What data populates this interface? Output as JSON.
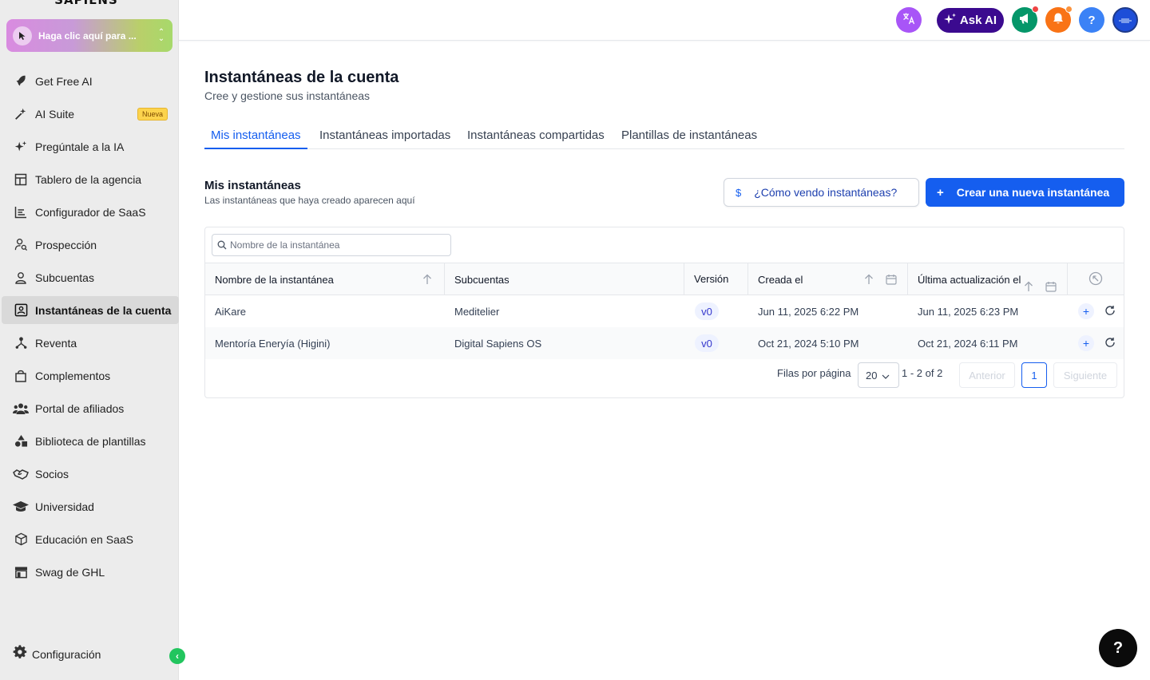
{
  "brand": "SAPIENS",
  "switcher": {
    "label": "Haga clic aquí para ..."
  },
  "sidebar": {
    "items": [
      {
        "label": "Get Free AI",
        "icon": "rocket-icon"
      },
      {
        "label": "AI Suite",
        "icon": "sparkle-wand-icon",
        "badge": "Nueva"
      },
      {
        "label": "Pregúntale a la IA",
        "icon": "sparkles-icon"
      },
      {
        "label": "Tablero de la agencia",
        "icon": "dashboard-icon"
      },
      {
        "label": "Configurador de SaaS",
        "icon": "bar-chart-icon"
      },
      {
        "label": "Prospección",
        "icon": "user-search-icon"
      },
      {
        "label": "Subcuentas",
        "icon": "user-icon"
      },
      {
        "label": "Instantáneas de la cuenta",
        "icon": "snapshot-icon",
        "active": true
      },
      {
        "label": "Reventa",
        "icon": "network-icon"
      },
      {
        "label": "Complementos",
        "icon": "bag-icon"
      },
      {
        "label": "Portal de afiliados",
        "icon": "users-icon"
      },
      {
        "label": "Biblioteca de plantillas",
        "icon": "shapes-icon"
      },
      {
        "label": "Socios",
        "icon": "handshake-icon"
      },
      {
        "label": "Universidad",
        "icon": "graduation-cap-icon"
      },
      {
        "label": "Educación en SaaS",
        "icon": "cube-icon"
      },
      {
        "label": "Swag de GHL",
        "icon": "store-icon"
      }
    ],
    "settings_label": "Configuración"
  },
  "topbar": {
    "ask_ai_label": "Ask AI",
    "help_label": "?"
  },
  "page": {
    "title": "Instantáneas de la cuenta",
    "subtitle": "Cree y gestione sus instantáneas",
    "tabs": [
      "Mis instantáneas",
      "Instantáneas importadas",
      "Instantáneas compartidas",
      "Plantillas de instantáneas"
    ],
    "section_title": "Mis instantáneas",
    "section_subtitle": "Las instantáneas que haya creado aparecen aquí",
    "how_sell_label": "¿Cómo vendo instantáneas?",
    "create_label": "Crear una nueva instantánea"
  },
  "table": {
    "search_placeholder": "Nombre de la instantánea",
    "columns": [
      "Nombre de la instantánea",
      "Subcuentas",
      "Versión",
      "Creada el",
      "Última actualización el"
    ],
    "rows": [
      {
        "name": "AiKare",
        "subaccount": "Meditelier",
        "version": "v0",
        "created": "Jun 11, 2025 6:22 PM",
        "updated": "Jun 11, 2025 6:23 PM"
      },
      {
        "name": "Mentoría Eneryía (Higini)",
        "subaccount": "Digital Sapiens OS",
        "version": "v0",
        "created": "Oct 21, 2024 5:10 PM",
        "updated": "Oct 21, 2024 6:11 PM"
      }
    ]
  },
  "pagination": {
    "rows_per_page_label": "Filas por página",
    "rows_per_page": "20",
    "range": "1 - 2 of 2",
    "prev_label": "Anterior",
    "current_page": "1",
    "next_label": "Siguiente"
  },
  "fab": {
    "label": "?"
  }
}
